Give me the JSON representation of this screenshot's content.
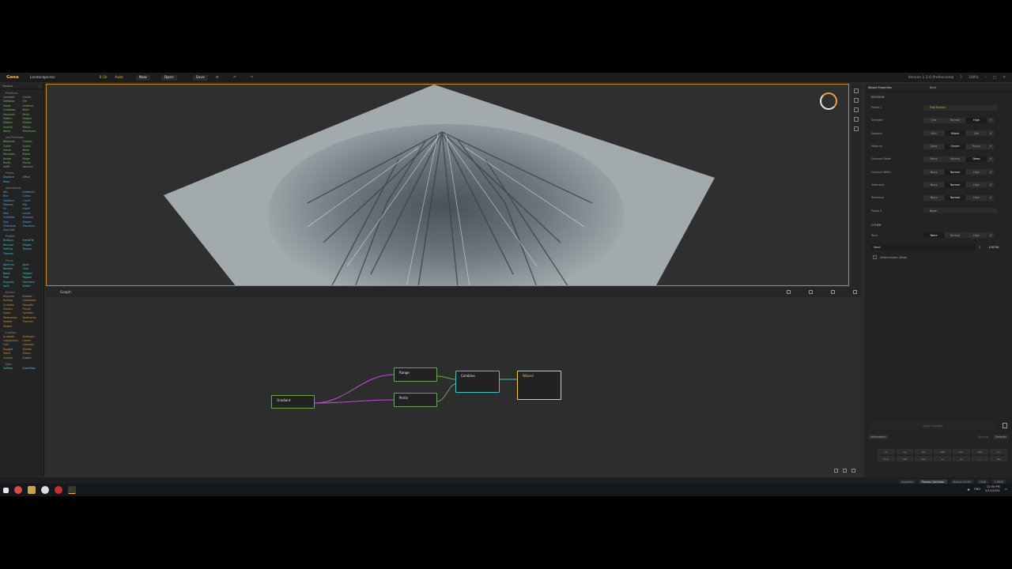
{
  "menubar": {
    "app_name": "Gaea",
    "file_name": "Landscape.tor",
    "resolution": "0.5k",
    "mode": "Auto",
    "new_label": "New",
    "open_label": "Open",
    "save_label": "Save",
    "version": "Version 1.3.0 Professional",
    "zoom": "100%"
  },
  "library": {
    "title": "Toolbox",
    "sections": [
      {
        "title": "Primitives",
        "color": "c-green",
        "items": [
          "Constant",
          "Cracks",
          "DotNoise",
          "File",
          "Gabor",
          "Gradient",
          "LineNoise",
          "Mask",
          "Mountain",
          "Perlin",
          "Pattern",
          "Ridged",
          "Shapes",
          "Stripes",
          "Voronoi",
          "Waves",
          "Noise",
          "Wireframe"
        ]
      },
      {
        "title": "Geo Primitives",
        "color": "c-green",
        "items": [
          "Badlands",
          "Canyon",
          "Crater",
          "Dunes",
          "Island",
          "Mesa",
          "Mountain",
          "Plates",
          "Range",
          "Ridge",
          "Rocky",
          "Slump",
          "Uplift",
          "Volcano"
        ]
      },
      {
        "title": "Places",
        "color": "c-teal",
        "items": [
          "Displace",
          "Offset",
          "Warp",
          ""
        ]
      },
      {
        "title": "Adjustments",
        "color": "c-blue",
        "items": [
          "Abs",
          "Autolevel",
          "Blur",
          "Clamp",
          "Combine",
          "Curve",
          "Gamma",
          "Flip",
          "Fx",
          "Invert",
          "Heal",
          "Levels",
          "MultiFold",
          "Sharpen",
          "Sine",
          "Shaper",
          "Threshold",
          "Transform",
          "Zero Edit",
          ""
        ]
      },
      {
        "title": "Profiles",
        "color": "c-teal",
        "items": [
          "Bulbous",
          "FractalTe",
          "Recurse",
          "Shaper",
          "SoftClip",
          "Terrace",
          "Thermal",
          "",
          ""
        ]
      },
      {
        "title": "Filters",
        "color": "c-teal",
        "items": [
          "Aperture",
          "Apex",
          "Bomber",
          "Cells",
          "Noise",
          "Origami",
          "Pixel",
          "Repeat",
          "Rugosity",
          "Seamless",
          "Swirl",
          "Wheel"
        ]
      },
      {
        "title": "Erosion",
        "color": "c-orange",
        "items": [
          "Alluvium",
          "Breaker",
          "Buildup",
          "Contractor",
          "Crumble",
          "Deposits",
          "Erosion",
          "Fluvial",
          "Hydro",
          "Hydrofix",
          "Meandrous",
          "Sediments",
          "Shatter",
          "Thermal",
          "Wizard",
          ""
        ]
      },
      {
        "title": "LookDev",
        "color": "c-orange",
        "items": [
          "Acrobatic",
          "Anthropic",
          "Languorous",
          "Carver",
          "Fold",
          "Outcrops",
          "Rugged",
          "Shatter",
          "Sheet",
          "Stacks",
          "Surface",
          "Rubble"
        ]
      },
      {
        "title": "Data",
        "color": "c-teal",
        "items": [
          "SatMap",
          "SuperMap"
        ]
      }
    ]
  },
  "graph": {
    "tab": "Graph",
    "nodes": {
      "gradient": "Gradient",
      "range": "Range",
      "perlin": "Perlin",
      "combine": "Combine",
      "wizard": "Wizard"
    }
  },
  "props": {
    "title": "Wizard Properties",
    "tab2": "Build",
    "erosion_title": "EROSION",
    "preset_label": "Phase 1",
    "preset_value": "Fast Erosion",
    "rows": [
      {
        "label": "Strength",
        "options": [
          "Low",
          "Normal",
          "High"
        ],
        "selected": 2
      },
      {
        "label": "Seasons",
        "options": [
          "Mild",
          "Mixed",
          "Soft"
        ],
        "selected": 1
      },
      {
        "label": "Material",
        "options": [
          "Sand",
          "Gravel",
          "Rocky"
        ],
        "selected": 1
      },
      {
        "label": "Channel Depth",
        "options": [
          "None",
          "Normal",
          "Deep"
        ],
        "selected": 2
      },
      {
        "label": "Channel Width",
        "options": [
          "None",
          "Normal",
          "High"
        ],
        "selected": 1
      },
      {
        "label": "Sediment",
        "options": [
          "None",
          "Normal",
          "High"
        ],
        "selected": 1
      },
      {
        "label": "Reinforce",
        "options": [
          "None",
          "Normal",
          "High"
        ],
        "selected": 1
      }
    ],
    "phase2_label": "Phase 2",
    "phase2_value": "None",
    "other_title": "OTHER",
    "rock_label": "Rock",
    "rock_options": [
      "None",
      "Normal",
      "High"
    ],
    "rock_selected": 0,
    "seed_label": "Seed",
    "seed_value": "118758",
    "deterministic_label": "Deterministic (Slow)",
    "apply_label": "Apply Changes",
    "information_label": "Information",
    "restore_label": "Restore",
    "defaults_label": "Defaults",
    "keys": [
      "In",
      "Lg",
      "Sq",
      "Diff",
      "Ero",
      "Sed",
      "Lo",
      "Flow",
      "Clip",
      "Rec",
      "∆",
      "∆",
      "→",
      "Rel"
    ]
  },
  "statusbar": {
    "items": [
      "Snapshot",
      "Process Optimizer",
      "Build in 00:00",
      "2048",
      "1.0618"
    ]
  },
  "taskbar": {
    "time": "12:00 PM",
    "date": "5/15/2023",
    "lang": "ENG"
  }
}
